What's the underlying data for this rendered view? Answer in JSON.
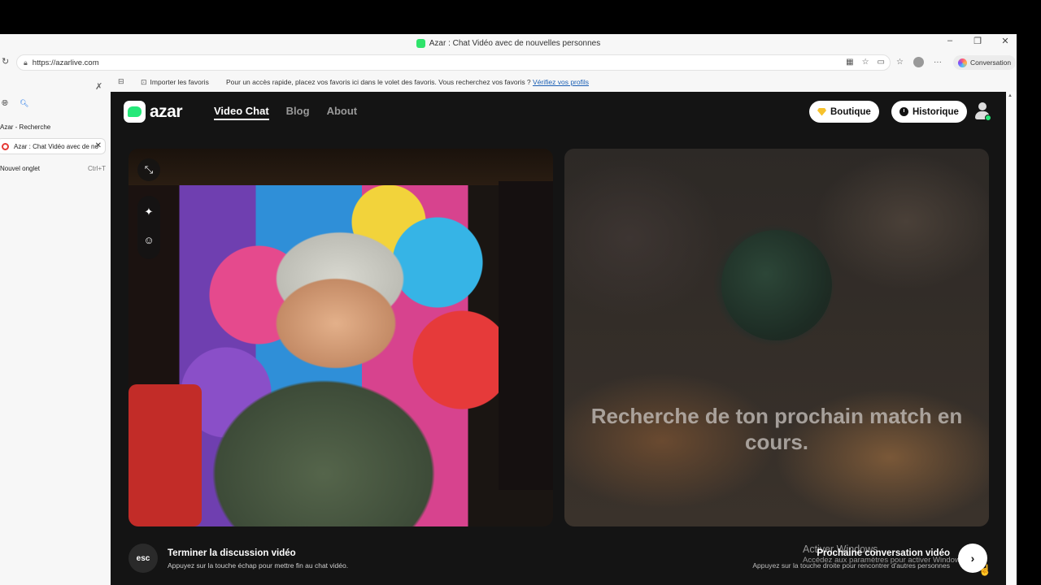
{
  "browser": {
    "window_title": "Azar : Chat Vidéo avec de nouvelles personnes",
    "url": "https://azarlive.com",
    "copilot_label": "Conversation",
    "favorites_import_label": "Importer les favoris",
    "favorites_tip": "Pour un accès rapide, placez vos favoris ici dans le volet des favoris. Vous recherchez vos favoris ?",
    "favorites_tip_link": "Vérifiez vos profils"
  },
  "sidebar": {
    "group_label": "Azar - Recherche",
    "active_tab": "Azar : Chat Vidéo avec de nouvelles personnes",
    "new_tab_label": "Nouvel onglet",
    "new_tab_shortcut": "Ctrl+T"
  },
  "site": {
    "logo_text": "azar",
    "nav": [
      "Video Chat",
      "Blog",
      "About"
    ],
    "shop_label": "Boutique",
    "history_label": "Historique"
  },
  "video": {
    "searching_text": "Recherche de ton prochain match en cours."
  },
  "bottom": {
    "esc_label": "esc",
    "end_title": "Terminer la discussion vidéo",
    "end_subtitle": "Appuyez sur la touche échap pour mettre fin au chat vidéo.",
    "next_title": "Prochaine conversation vidéo",
    "next_subtitle": "Appuyez sur la touche droite pour rencontrer d'autres personnes",
    "next_arrow": "›"
  },
  "watermark": {
    "line1": "Activer Windows",
    "line2": "Accédez aux paramètres pour activer Windows."
  },
  "icons": [
    "refresh-icon",
    "lock-icon",
    "pin-off-icon",
    "globe-icon",
    "search-icon",
    "close-icon",
    "expand-icon",
    "magic-wand-icon",
    "sticker-icon",
    "gem-icon",
    "clock-icon",
    "profile-icon"
  ],
  "colors": {
    "brand_green": "#25e879",
    "page_bg": "#141414"
  }
}
